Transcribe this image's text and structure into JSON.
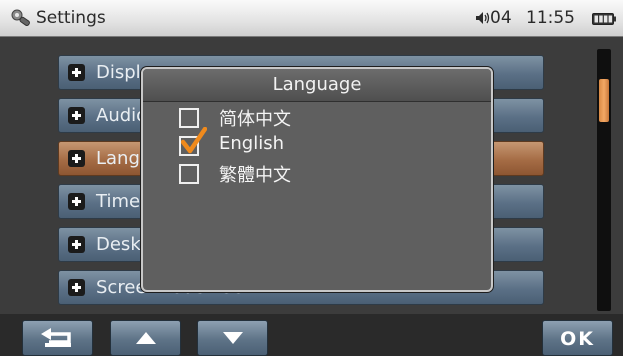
{
  "status_bar": {
    "title": "Settings",
    "volume": "04",
    "time": "11:55"
  },
  "menu": {
    "items": [
      {
        "label": "Display"
      },
      {
        "label": "Audio"
      },
      {
        "label": "Language",
        "selected": true
      },
      {
        "label": "Time"
      },
      {
        "label": "Desktop"
      },
      {
        "label": "Screen Touch Set"
      }
    ]
  },
  "dialog": {
    "title": "Language",
    "options": [
      {
        "label": "简体中文",
        "checked": false
      },
      {
        "label": "English",
        "checked": true
      },
      {
        "label": "繁體中文",
        "checked": false
      }
    ]
  },
  "toolbar": {
    "ok_label": "OK"
  },
  "colors": {
    "menu_item": "#5b7086",
    "selected_item": "#a56c45",
    "scroll_thumb": "#f3a865",
    "check_mark": "#f08a1c"
  },
  "icons": {
    "app": "settings-wrench-icon",
    "volume": "speaker-icon",
    "battery": "battery-icon",
    "back": "back-arrow-icon",
    "up": "arrow-up-icon",
    "down": "arrow-down-icon"
  }
}
